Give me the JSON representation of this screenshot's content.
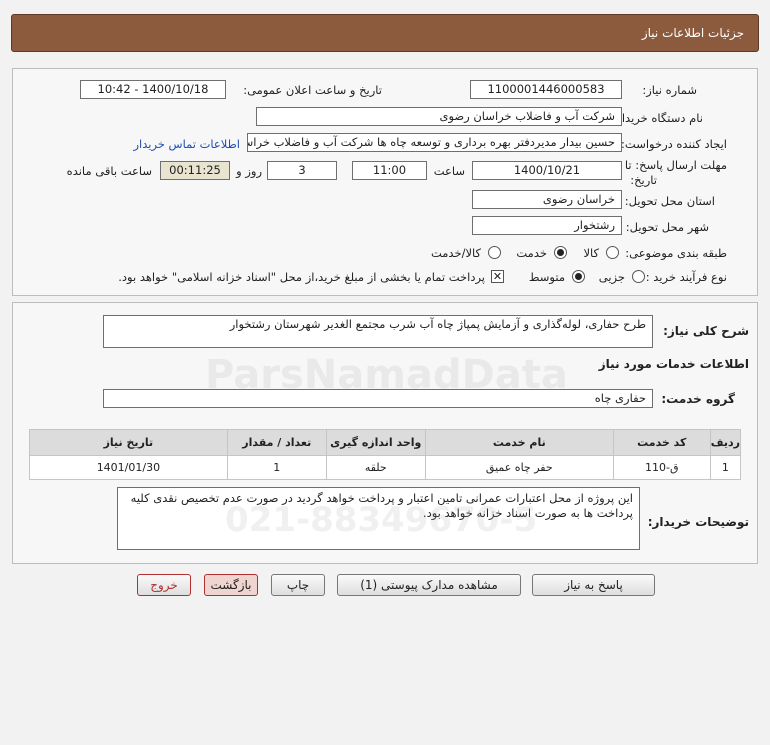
{
  "header": {
    "title": "جزئیات اطلاعات نیاز"
  },
  "fields": {
    "need_number_label": "شماره نیاز:",
    "need_number": "1100001446000583",
    "announce_label": "تاریخ و ساعت اعلان عمومی:",
    "announce_value": "1400/10/18 - 10:42",
    "buyer_label": "نام دستگاه خریدار:",
    "buyer_value": "شرکت آب و فاضلاب خراسان رضوی",
    "creator_label": "ایجاد کننده درخواست:",
    "creator_value": "حسین  بیدار مدیردفتر بهره برداری و توسعه چاه ها شرکت آب و فاضلاب خراسا",
    "contact_link": "اطلاعات تماس خریدار",
    "deadline_label_1": "مهلت ارسال پاسخ: تا",
    "deadline_label_2": "تاریخ:",
    "deadline_date": "1400/10/21",
    "time_label": "ساعت",
    "deadline_time": "11:00",
    "days_value": "3",
    "days_label": "روز و",
    "remaining_value": "00:11:25",
    "remaining_label": "ساعت باقی مانده",
    "province_label": "استان محل تحویل:",
    "province_value": "خراسان رضوی",
    "city_label": "شهر محل تحویل:",
    "city_value": "رشتخوار",
    "category_label": "طبقه بندی موضوعی:",
    "category_options": [
      "کالا",
      "خدمت",
      "کالا/خدمت"
    ],
    "category_selected": 1,
    "process_label": "نوع فرآیند خرید :",
    "process_options": [
      "جزیی",
      "متوسط"
    ],
    "process_selected": 1,
    "payment_note": "پرداخت تمام یا بخشی از مبلغ خرید،از محل \"اسناد خزانه اسلامی\" خواهد بود."
  },
  "description": {
    "label": "شرح کلی نیاز:",
    "value": "طرح حفاری، لوله‌گذاری و آزمایش پمپاژ چاه آب شرب مجتمع الغدیر شهرستان رشتخوار"
  },
  "services": {
    "section_title": "اطلاعات خدمات مورد نیاز",
    "group_label": "گروه خدمت:",
    "group_value": "حفاری چاه",
    "columns": [
      "ردیف",
      "کد خدمت",
      "نام خدمت",
      "واحد اندازه گیری",
      "تعداد / مقدار",
      "تاریخ نیاز"
    ],
    "rows": [
      [
        "1",
        "ق-110",
        "حفر چاه عمیق",
        "حلقه",
        "1",
        "1401/01/30"
      ]
    ]
  },
  "buyer_notes": {
    "label": "توضیحات خریدار:",
    "value": "این پروژه از محل اعتبارات عمرانی تامین اعتبار و پرداخت خواهد گردید در صورت عدم تخصیص نقدی کلیه پرداخت ها به صورت اسناد خزانه خواهد بود."
  },
  "buttons": {
    "reply": "پاسخ به نیاز",
    "attachments": "مشاهده مدارک پیوستی (1)",
    "print": "چاپ",
    "back": "بازگشت",
    "exit": "خروج"
  },
  "watermark": {
    "brand": "ParsNamadData",
    "phone": "021-88349670-5"
  }
}
